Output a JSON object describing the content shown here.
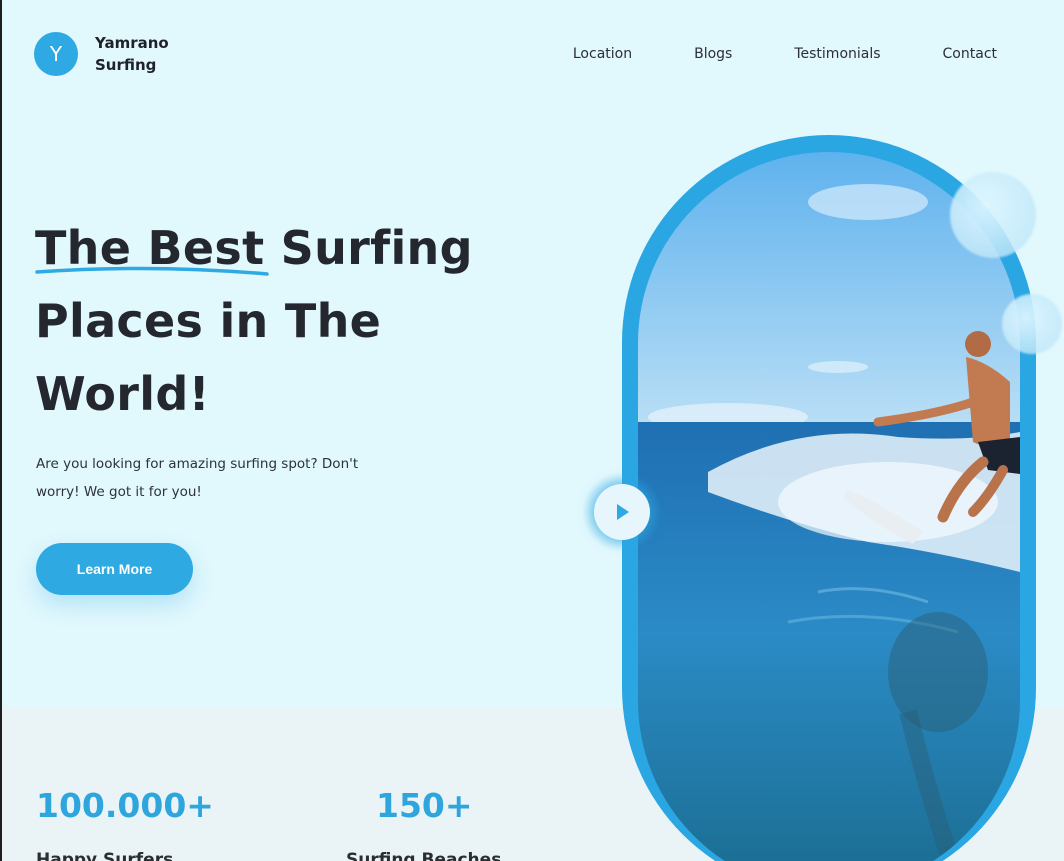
{
  "brand": {
    "badge_letter": "Y",
    "name": "Yamrano Surfing"
  },
  "nav": {
    "items": [
      "Location",
      "Blogs",
      "Testimonials",
      "Contact"
    ]
  },
  "hero": {
    "title": "The Best Surfing Places in The World!",
    "description": "Are you looking for amazing surfing spot? Don't worry! We got it for you!",
    "cta_label": "Learn More"
  },
  "stats": [
    {
      "value": "100.000+",
      "label": "Happy Surfers"
    },
    {
      "value": "150+",
      "label": "Surfing Beaches"
    }
  ],
  "media": {
    "image_alt": "surfer riding a wave",
    "play_icon": "play-icon"
  },
  "colors": {
    "accent": "#2fa9e2",
    "background": "#e1f8fd",
    "heading": "#24272e"
  }
}
